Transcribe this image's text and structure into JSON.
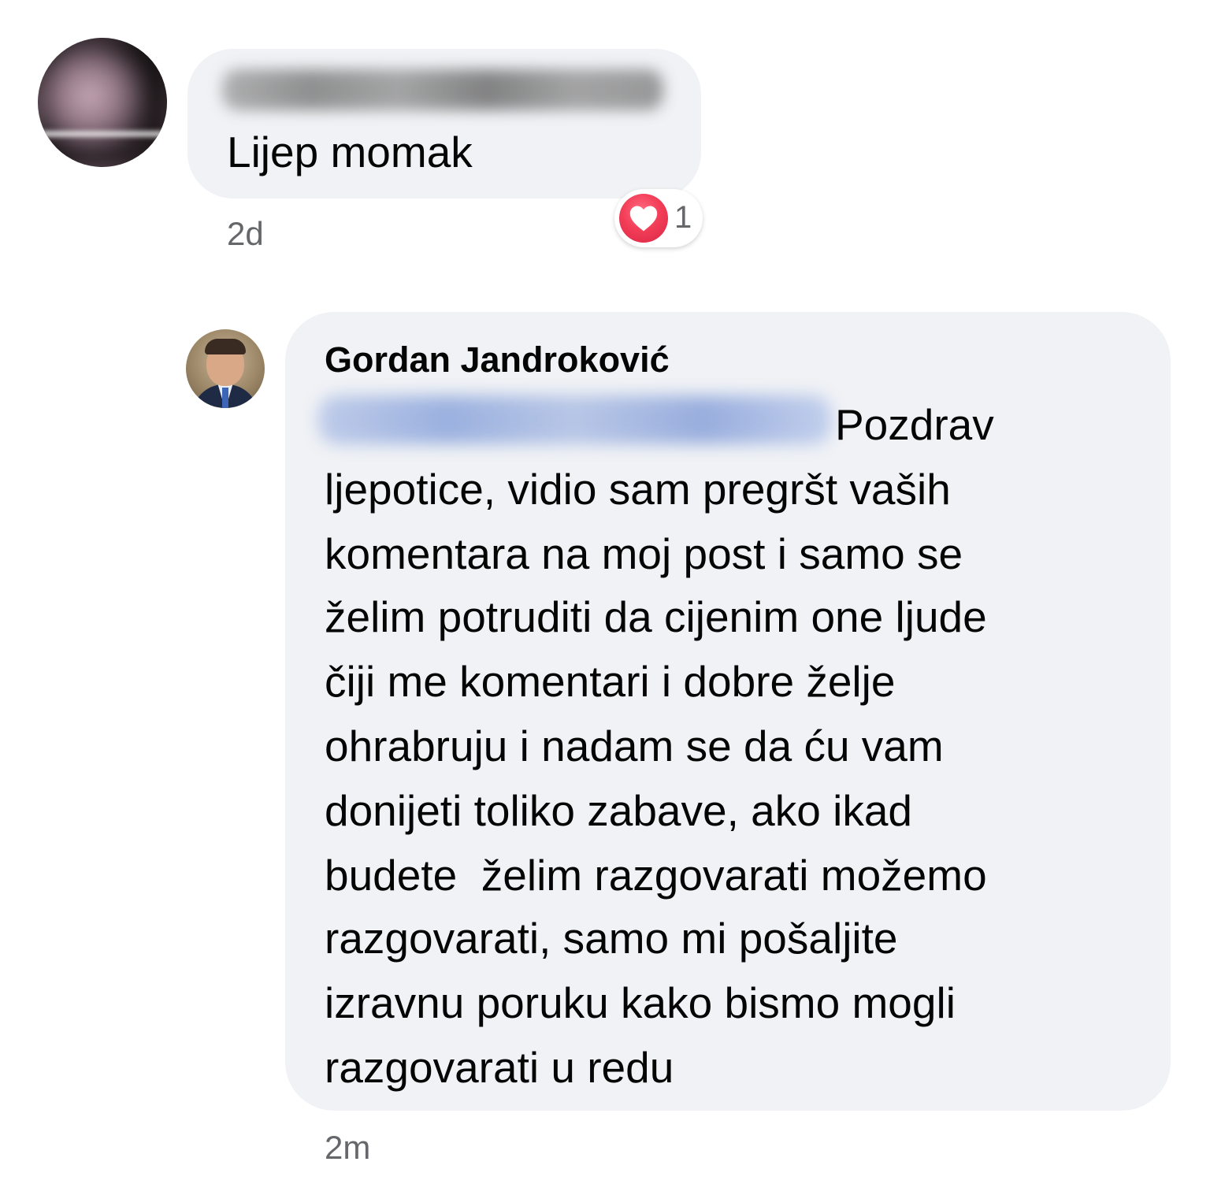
{
  "comment1": {
    "text": "Lijep momak",
    "time": "2d",
    "reaction": {
      "icon": "heart-icon",
      "count": "1",
      "color": "#f33e58"
    }
  },
  "reply": {
    "author": "Gordan Jandroković",
    "lines": [
      "Pozdrav",
      "ljepotice, vidio sam pregršt vaših",
      "komentara na moj post i samo se",
      "želim potruditi da cijenim one ljude",
      "čiji me komentari i dobre želje",
      "ohrabruju i nadam se da ću vam",
      "donijeti toliko zabave, ako ikad",
      "budete  želim razgovarati možemo",
      "razgovarati, samo mi pošaljite",
      "izravnu poruku kako bismo mogli",
      "razgovarati u redu"
    ],
    "time": "2m"
  },
  "colors": {
    "bubble_bg": "#f0f2f5",
    "secondary_text": "#65676b",
    "mention_blue": "#7f9bd8"
  }
}
